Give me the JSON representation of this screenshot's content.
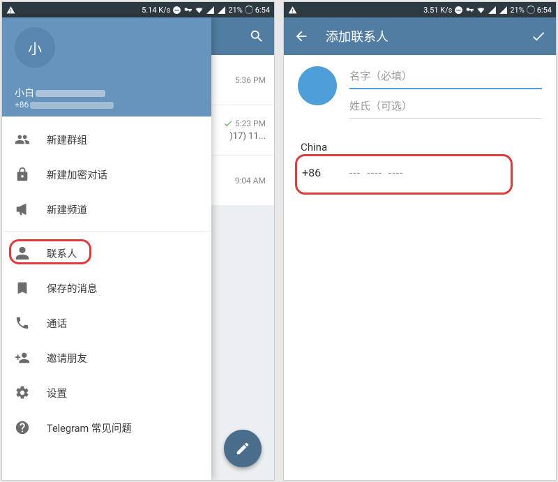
{
  "status": {
    "left_speed": "5.14 K/s",
    "right_speed": "3.51 K/s",
    "battery": "21%",
    "time": "6:54"
  },
  "left": {
    "avatar_letter": "小",
    "user_name_prefix": "小白",
    "user_phone_prefix": "+86",
    "chats": {
      "t1": "5:36 PM",
      "t2": "5:23 PM",
      "t2_sub": ")17) 11...",
      "t3": "9:04 AM"
    },
    "menu": {
      "new_group": "新建群组",
      "new_secret": "新建加密对话",
      "new_channel": "新建频道",
      "contacts": "联系人",
      "saved": "保存的消息",
      "calls": "通话",
      "invite": "邀请朋友",
      "settings": "设置",
      "faq": "Telegram 常见问题"
    }
  },
  "right": {
    "title": "添加联系人",
    "first_name_ph": "名字（必填）",
    "last_name_ph": "姓氏（可选）",
    "country": "China",
    "code": "+86",
    "dashes": "--- ---- ----"
  }
}
